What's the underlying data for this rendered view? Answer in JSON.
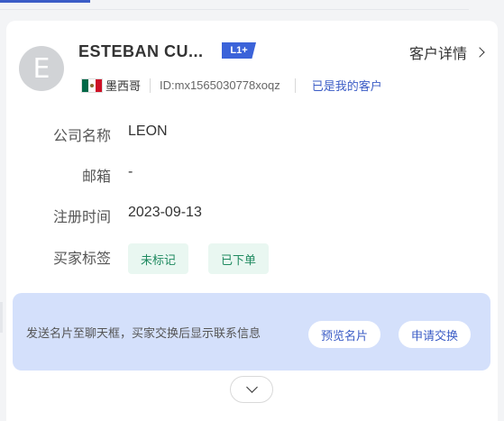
{
  "customer": {
    "avatar_letter": "E",
    "name": "ESTEBAN CU...",
    "level": "L1+",
    "detail_link": "客户详情",
    "country": "墨西哥",
    "id_text": "ID:mx1565030778xoqz",
    "relation": "已是我的客户"
  },
  "info": {
    "company_label": "公司名称",
    "company_value": "LEON",
    "email_label": "邮箱",
    "email_value": "-",
    "registered_label": "注册时间",
    "registered_value": "2023-09-13",
    "tags_label": "买家标签",
    "tags": [
      "未标记",
      "已下单"
    ]
  },
  "banner": {
    "text": "发送名片至聊天框，买家交换后显示联系信息",
    "preview_button": "预览名片",
    "exchange_button": "申请交换"
  },
  "colors": {
    "accent": "#3b5cc6",
    "tag_bg": "#e9f7f1",
    "tag_text": "#1f8a60",
    "banner_bg": "#d4e0fb",
    "flag_green": "#006847",
    "flag_red": "#ce1126"
  }
}
